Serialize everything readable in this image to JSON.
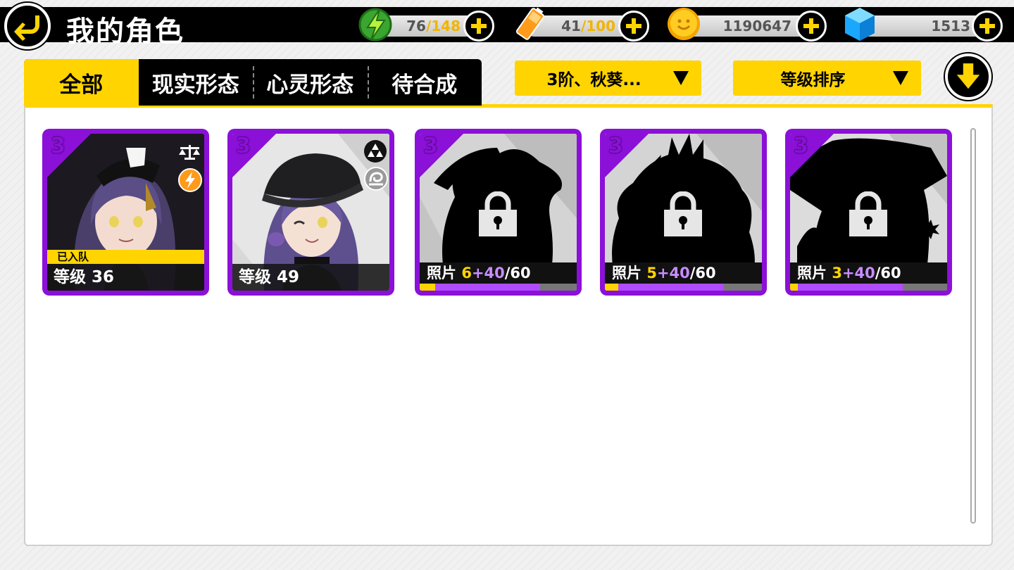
{
  "header": {
    "title": "我的角色",
    "resources": {
      "energy": {
        "current": "76",
        "max": "/148"
      },
      "battery": {
        "current": "41",
        "max": "/100"
      },
      "coins": {
        "value": "1190647"
      },
      "diamonds": {
        "value": "1513"
      }
    }
  },
  "tabs": [
    {
      "label": "全部",
      "active": true
    },
    {
      "label": "现实形态",
      "active": false
    },
    {
      "label": "心灵形态",
      "active": false
    },
    {
      "label": "待合成",
      "active": false
    }
  ],
  "filters": {
    "rank_filter": "3阶、秋葵...",
    "sort": "等级排序"
  },
  "cards": [
    {
      "rank": "3",
      "owned": true,
      "in_team": true,
      "team_label": "已入队",
      "level_text": "等级 36",
      "badges": [
        "scales-icon",
        "lightning-icon"
      ]
    },
    {
      "rank": "3",
      "owned": true,
      "in_team": false,
      "level_text": "等级 49",
      "badges": [
        "triforce-icon",
        "swirl-icon"
      ]
    },
    {
      "rank": "3",
      "owned": false,
      "photo_label": "照片",
      "have": "6",
      "add": "+40",
      "need": "/60",
      "progress_have": 0.1,
      "progress_add": 0.667
    },
    {
      "rank": "3",
      "owned": false,
      "photo_label": "照片",
      "have": "5",
      "add": "+40",
      "need": "/60",
      "progress_have": 0.083,
      "progress_add": 0.667
    },
    {
      "rank": "3",
      "owned": false,
      "photo_label": "照片",
      "have": "3",
      "add": "+40",
      "need": "/60",
      "progress_have": 0.05,
      "progress_add": 0.667
    }
  ],
  "colors": {
    "accent": "#ffd400",
    "rank_purple": "#8b10d8",
    "progress_purple": "#b04cff"
  }
}
